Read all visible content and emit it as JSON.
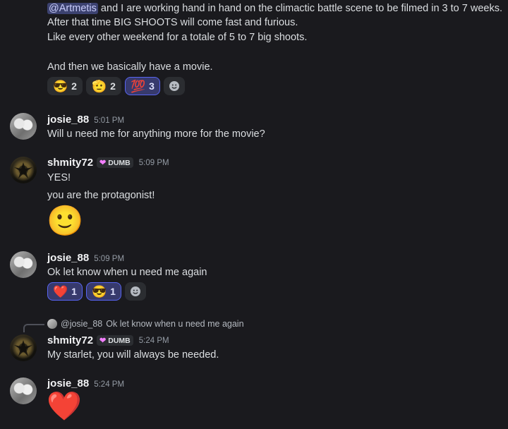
{
  "top_message": {
    "mention": "@Artmetis",
    "line1_rest": " and I are working hand in hand on the climactic battle scene to be filmed in 3 to 7 weeks.",
    "line2": "After that time BIG SHOOTS will come fast and furious.",
    "line3": "Like every other weekend for a totale of 5 to 7 big shoots.",
    "line4": "And then we basically have a movie.",
    "reactions": [
      {
        "emoji": "😎",
        "count": "2"
      },
      {
        "emoji": "🫡",
        "count": "2"
      },
      {
        "emoji": "💯",
        "count": "3"
      }
    ]
  },
  "messages": [
    {
      "author": "josie_88",
      "time": "5:01 PM",
      "text": "Will u need me for anything more for the movie?"
    },
    {
      "author": "shmity72",
      "tag": "DUMB",
      "time": "5:09 PM",
      "text1": "YES!",
      "text2": "you are the protagonist!",
      "emoji": "🙂"
    },
    {
      "author": "josie_88",
      "time": "5:09 PM",
      "text": "Ok let know when u need me again",
      "reactions": [
        {
          "emoji": "❤️",
          "count": "1"
        },
        {
          "emoji": "😎",
          "count": "1"
        }
      ]
    },
    {
      "author": "shmity72",
      "tag": "DUMB",
      "time": "5:24 PM",
      "reply_author": "@josie_88",
      "reply_text": "Ok let know when u need me again",
      "text": "My starlet, you will always be needed."
    },
    {
      "author": "josie_88",
      "time": "5:24 PM",
      "emoji": "❤️"
    }
  ],
  "icons": {
    "add_reaction": "smiley-add-icon",
    "role_tag_heart": "heart-icon"
  },
  "colors": {
    "background": "#1a1a1e",
    "mention_bg": "#3c4270",
    "reaction_active_border": "#5865f2",
    "role_heart": "#f47fff"
  }
}
